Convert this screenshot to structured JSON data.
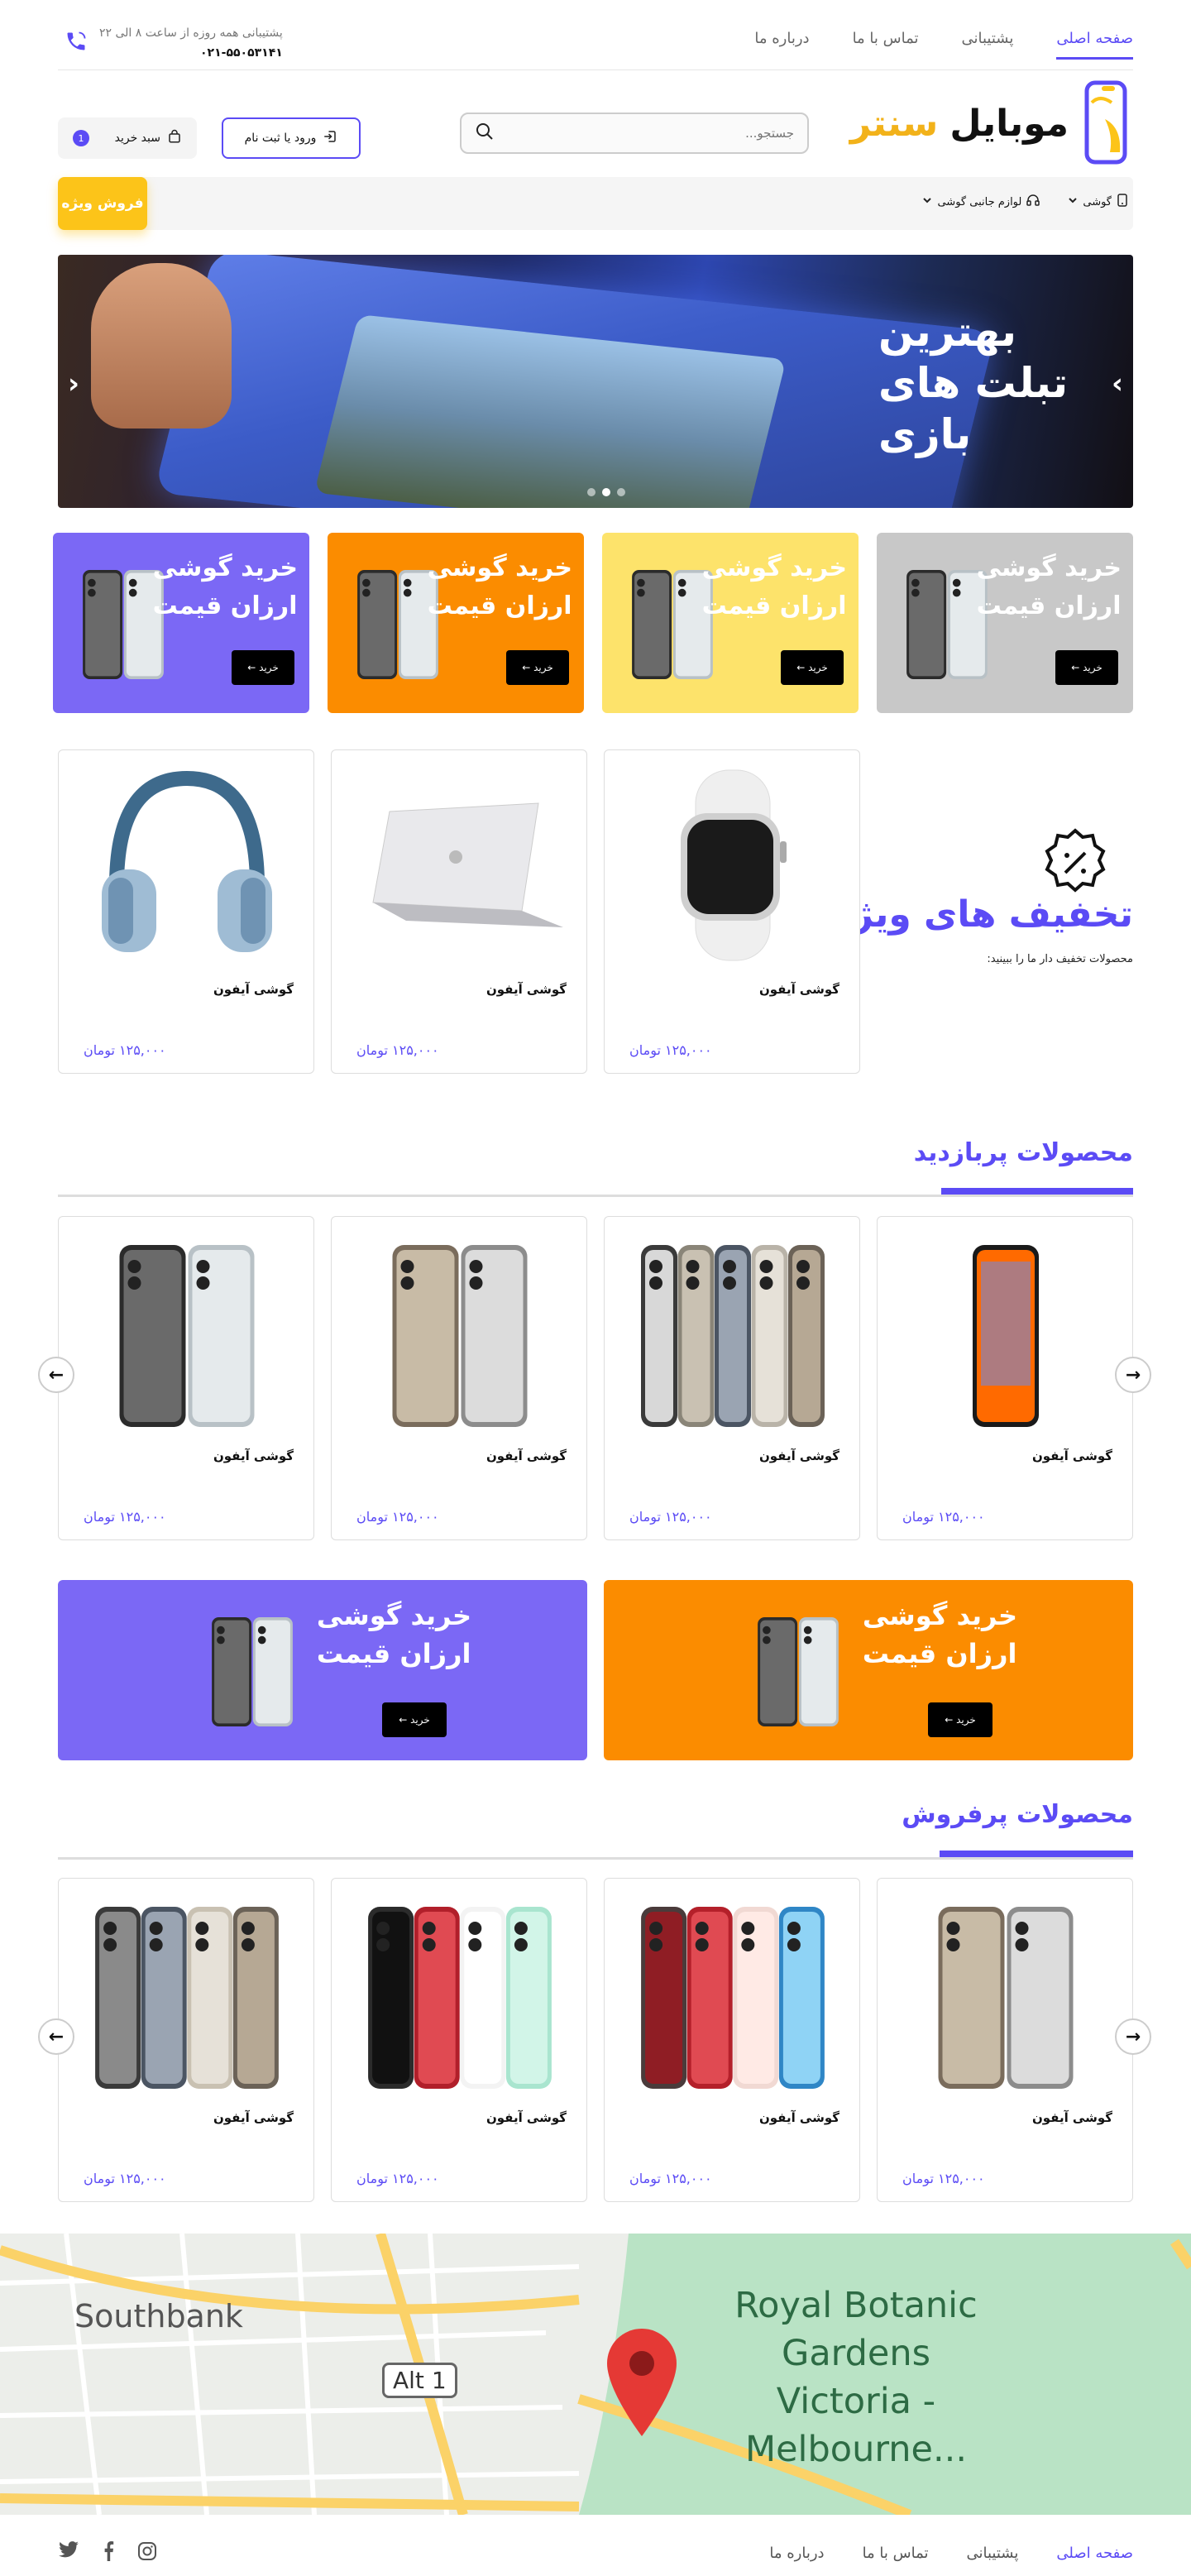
{
  "nav": {
    "items": [
      "صفحه اصلی",
      "پشتیبانی",
      "تماس با ما",
      "درباره ما"
    ],
    "active_index": 0
  },
  "support": {
    "line1": "پشتیبانی همه روزه از ساعت ۸ الی ۲۲",
    "phone": "۰۲۱-۵۵۰۵۳۱۴۱"
  },
  "header": {
    "logo_part1": "موبایل",
    "logo_part2": "سنتر",
    "search_placeholder": "جستجو...",
    "login_label": "ورود یا ثبت نام",
    "cart_label": "سبد خرید",
    "cart_count": "1"
  },
  "categories": {
    "items": [
      "گوشی",
      "لوازم جانبی گوشی"
    ],
    "special_label": "فروش ویژه"
  },
  "hero": {
    "title_lines": [
      "بهترین",
      "تبلت های",
      "بازی"
    ],
    "slide_count": 3,
    "active_slide": 1
  },
  "promos": [
    {
      "title_l1": "خرید گوشی",
      "title_l2": "ارزان قیمت",
      "button": "خرید ←",
      "color": "#c8c8c8"
    },
    {
      "title_l1": "خرید گوشی",
      "title_l2": "ارزان قیمت",
      "button": "خرید ←",
      "color": "#fde36b"
    },
    {
      "title_l1": "خرید گوشی",
      "title_l2": "ارزان قیمت",
      "button": "خرید ←",
      "color": "#fb8c00"
    },
    {
      "title_l1": "خرید گوشی",
      "title_l2": "ارزان قیمت",
      "button": "خرید ←",
      "color": "#7b68f5"
    }
  ],
  "discount": {
    "title": "تخفیف های ویژه",
    "subtitle": "محصولات تخفیف دار ما را ببینید:",
    "products": [
      {
        "name": "گوشی آیفون",
        "price": "۱۲۵,۰۰۰ تومان",
        "icon": "watch"
      },
      {
        "name": "گوشی آیفون",
        "price": "۱۲۵,۰۰۰ تومان",
        "icon": "laptop"
      },
      {
        "name": "گوشی آیفون",
        "price": "۱۲۵,۰۰۰ تومان",
        "icon": "headphones"
      }
    ]
  },
  "popular": {
    "title": "محصولات پربازدید",
    "products": [
      {
        "name": "گوشی آیفون",
        "price": "۱۲۵,۰۰۰ تومان",
        "icon": "phone-screen"
      },
      {
        "name": "گوشی آیفون",
        "price": "۱۲۵,۰۰۰ تومان",
        "icon": "phone-titanium"
      },
      {
        "name": "گوشی آیفون",
        "price": "۱۲۵,۰۰۰ تومان",
        "icon": "phone-colors"
      },
      {
        "name": "گوشی آیفون",
        "price": "۱۲۵,۰۰۰ تومان",
        "icon": "phone-black"
      }
    ]
  },
  "promos2": [
    {
      "title_l1": "خرید گوشی",
      "title_l2": "ارزان قیمت",
      "button": "خرید ←",
      "color": "#fb8c00"
    },
    {
      "title_l1": "خرید گوشی",
      "title_l2": "ارزان قیمت",
      "button": "خرید ←",
      "color": "#7b68f5"
    }
  ],
  "bestsellers": {
    "title": "محصولات پرفروش",
    "products": [
      {
        "name": "گوشی آیفون",
        "price": "۱۲۵,۰۰۰ تومان",
        "icon": "phone-colors"
      },
      {
        "name": "گوشی آیفون",
        "price": "۱۲۵,۰۰۰ تومان",
        "icon": "phone-red"
      },
      {
        "name": "گوشی آیفون",
        "price": "۱۲۵,۰۰۰ تومان",
        "icon": "phone-mint"
      },
      {
        "name": "گوشی آیفون",
        "price": "۱۲۵,۰۰۰ تومان",
        "icon": "phone-blue"
      }
    ]
  },
  "map": {
    "label_park": "Royal Botanic Gardens Victoria - Melbourne...",
    "label_area": "Southbank",
    "label_road": "Alt 1"
  },
  "footer": {
    "items": [
      "صفحه اصلی",
      "پشتیبانی",
      "تماس با ما",
      "درباره ما"
    ],
    "social": [
      "instagram-icon",
      "facebook-icon",
      "twitter-icon"
    ]
  },
  "colors": {
    "accent": "#5b4bf5",
    "yellow": "#fcc419"
  }
}
